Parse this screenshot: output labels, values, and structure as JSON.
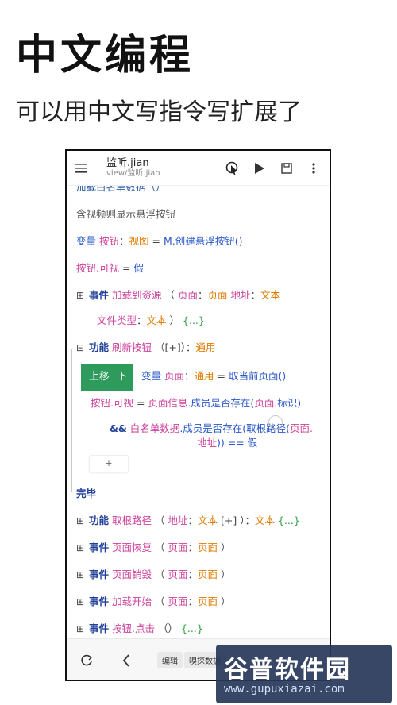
{
  "hero": {
    "title": "中文编程",
    "subtitle": "可以用中文写指令写扩展了"
  },
  "appbar": {
    "title": "监听.jian",
    "path": "view/监听.jian"
  },
  "editor": {
    "clipped_line": "加载白名单数据（）",
    "comment_line": "含视频则显示悬浮按钮",
    "line_create": {
      "kw": "变量",
      "name": "按钮",
      "colon": "：",
      "type": "视图",
      "eq": "=",
      "value": "M.创建悬浮按钮()"
    },
    "line_visible": {
      "target": "按钮.可视",
      "eq": "=",
      "value": "假"
    },
    "event_load": {
      "expander": "⊞",
      "kw": "事件",
      "name": "加载到资源",
      "open": "（",
      "p1": "页面",
      "c1": "：",
      "t1": "页面",
      "p2": "地址",
      "c2": "：",
      "t2": "文本"
    },
    "event_load_cont": {
      "p3": "文件类型",
      "c3": "：",
      "t3": "文本",
      "close": "）",
      "dots": "{...}"
    },
    "func_refresh": {
      "expander": "⊟",
      "kw": "功能",
      "name": "刷新按钮",
      "args": "（[+]）",
      "colon": "：",
      "type": "通用"
    },
    "move_toolbar": {
      "up": "上移",
      "down": "下"
    },
    "line_page": {
      "kw": "变量",
      "name": "页面",
      "colon": "：",
      "type": "通用",
      "eq": "=",
      "value": "取当前页面()"
    },
    "line_assign": {
      "target": "按钮.可视",
      "eq": "=",
      "obj": "页面信息",
      "member": ".成员是否存在(",
      "arg": "页面",
      "arg_member": ".标识)"
    },
    "line_and": {
      "op": "&&",
      "obj": "白名单数据",
      "member": ".成员是否存在(取根路径(",
      "arg": "页面."
    },
    "line_and_cont": {
      "arg": "地址",
      "tail": ")) == ",
      "value": "假"
    },
    "add_button": "+",
    "end_line": "完毕",
    "func_rootpath": {
      "expander": "⊞",
      "kw": "功能",
      "name": "取根路径",
      "open": "（",
      "p1": "地址",
      "c1": "：",
      "t1": "文本",
      "extra": "[+]",
      "close": "）：",
      "ret": "文本",
      "dots": "{...}"
    },
    "event_resume": {
      "expander": "⊞",
      "kw": "事件",
      "name": "页面恢复",
      "open": "（",
      "p1": "页面",
      "c1": "：",
      "t1": "页面",
      "close": "）"
    },
    "event_destroy": {
      "expander": "⊞",
      "kw": "事件",
      "name": "页面销毁",
      "open": "（",
      "p1": "页面",
      "c1": "：",
      "t1": "页面",
      "close": "）"
    },
    "event_start": {
      "expander": "⊞",
      "kw": "事件",
      "name": "加载开始",
      "open": "（",
      "p1": "页面",
      "c1": "：",
      "t1": "页面",
      "close": "）"
    },
    "event_click": {
      "expander": "⊞",
      "kw": "事件",
      "name": "按钮.点击",
      "args": "（）",
      "dots": "{...}"
    }
  },
  "navbar": {
    "tabs": [
      "编辑",
      "嗅探数据"
    ]
  },
  "watermark": {
    "main": "谷普软件园",
    "url": "www.gupuxiazai.com"
  },
  "colors": {
    "keyword": "#2a58c8",
    "variable": "#cc3f9a",
    "type": "#e07b00",
    "toolbar_green": "#2e9b5d"
  }
}
